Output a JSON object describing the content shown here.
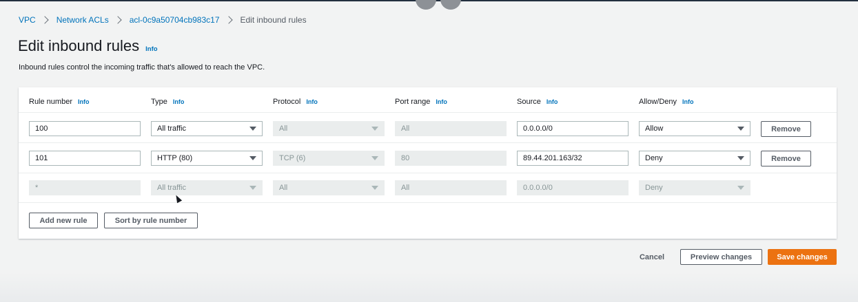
{
  "breadcrumb": [
    "VPC",
    "Network ACLs",
    "acl-0c9a50704cb983c17",
    "Edit inbound rules"
  ],
  "title": "Edit inbound rules",
  "info_label": "Info",
  "description": "Inbound rules control the incoming traffic that's allowed to reach the VPC.",
  "columns": [
    "Rule number",
    "Type",
    "Protocol",
    "Port range",
    "Source",
    "Allow/Deny"
  ],
  "rules": [
    {
      "number": "100",
      "type": "All traffic",
      "protocol": "All",
      "port_range": "All",
      "source": "0.0.0.0/0",
      "action": "Allow",
      "remove": "Remove"
    },
    {
      "number": "101",
      "type": "HTTP (80)",
      "protocol": "TCP (6)",
      "port_range": "80",
      "source": "89.44.201.163/32",
      "action": "Deny",
      "remove": "Remove"
    }
  ],
  "default_rule": {
    "number": "*",
    "type": "All traffic",
    "protocol": "All",
    "port_range": "All",
    "source": "0.0.0.0/0",
    "action": "Deny"
  },
  "buttons": {
    "add_rule": "Add new rule",
    "sort": "Sort by rule number",
    "cancel": "Cancel",
    "preview": "Preview changes",
    "save": "Save changes"
  },
  "colors": {
    "primary": "#ec7211",
    "link": "#0073bb",
    "header": "#232f3e"
  }
}
